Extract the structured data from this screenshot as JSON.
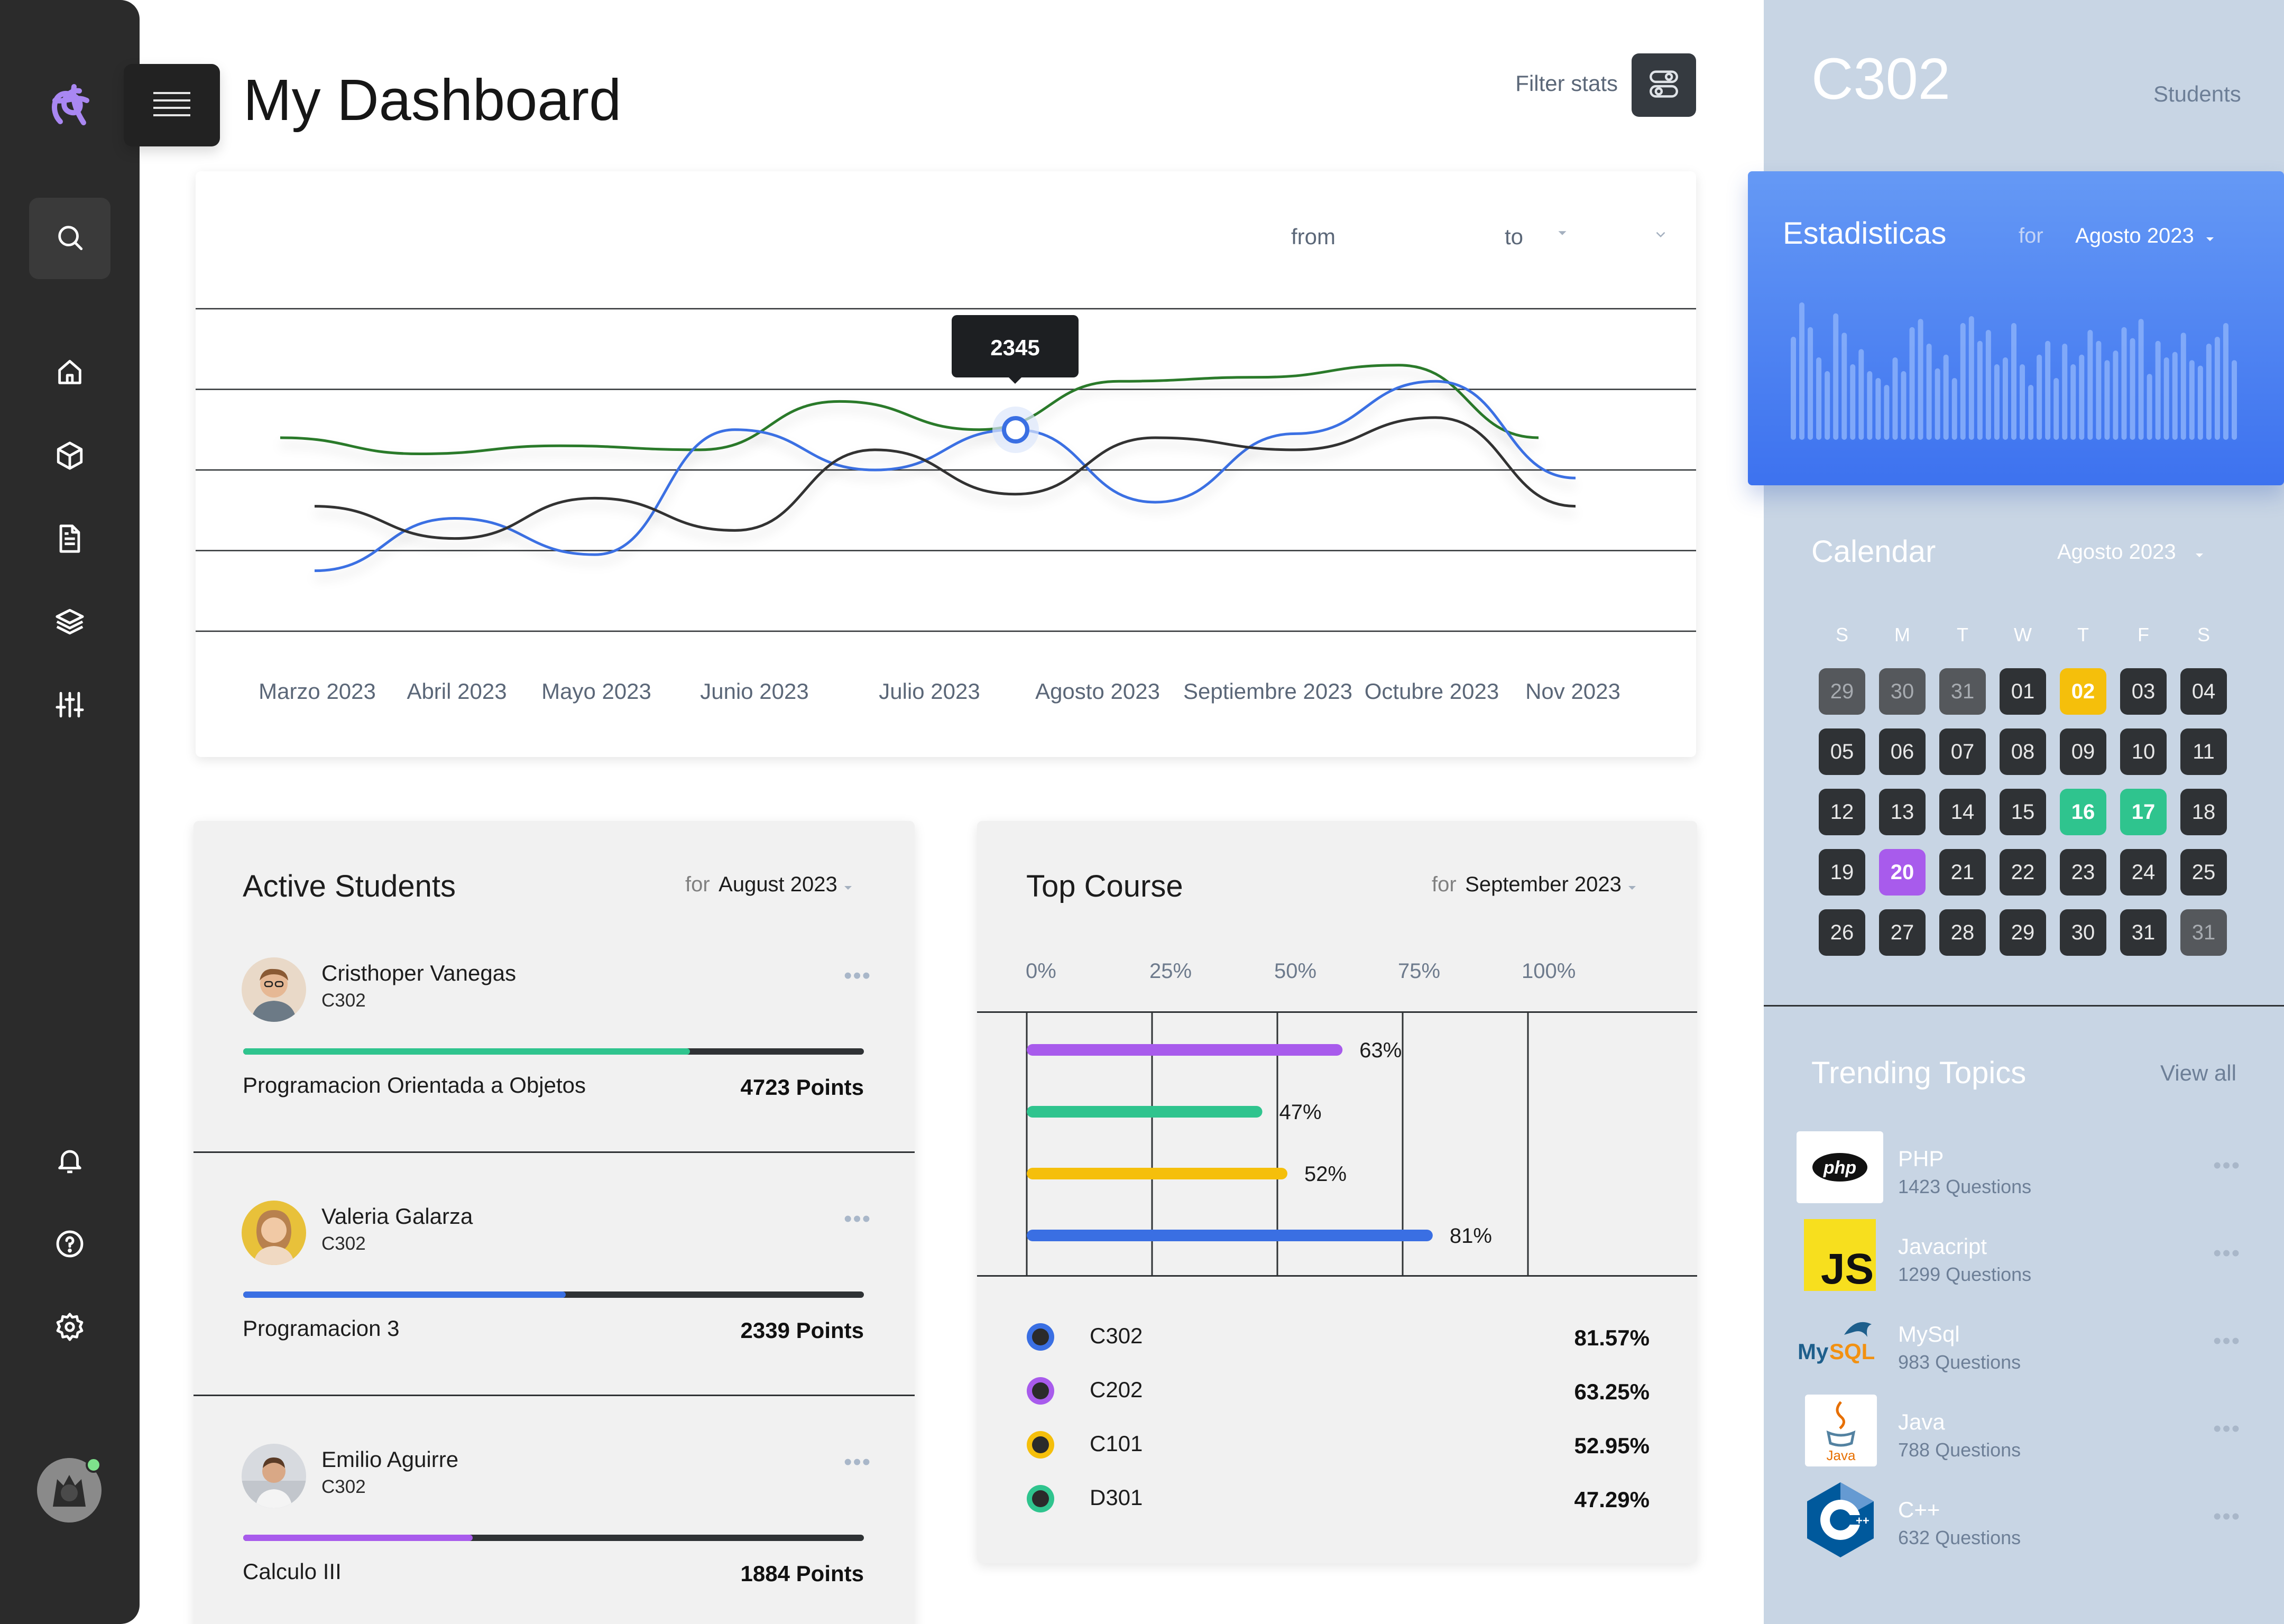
{
  "header": {
    "title": "My Dashboard",
    "filter_label": "Filter stats"
  },
  "sidebar": {
    "logo_icon": "knot-logo",
    "top_items": [
      "search-icon",
      "home-icon",
      "cube-icon",
      "document-icon",
      "layers-icon",
      "sliders-icon"
    ],
    "bottom_items": [
      "bell-icon",
      "help-icon",
      "gear-icon"
    ],
    "user_status": "online"
  },
  "line_chart": {
    "from_label": "from",
    "to_label": "to",
    "tooltip": "2345"
  },
  "chart_data": {
    "type": "line",
    "categories": [
      "Marzo 2023",
      "Abril 2023",
      "Mayo 2023",
      "Junio 2023",
      "Julio 2023",
      "Agosto 2023",
      "Septiembre 2023",
      "Octubre 2023",
      "Nov 2023"
    ],
    "y_domain": [
      0,
      4
    ],
    "grid": true,
    "legend": "none",
    "highlight": {
      "series": 1,
      "index": 4,
      "label": "2345"
    },
    "series": [
      {
        "color": "#2b7a2b",
        "values": [
          2.4,
          2.2,
          2.3,
          2.25,
          2.85,
          2.5,
          3.1,
          3.15,
          3.3,
          2.4
        ]
      },
      {
        "color": "#3a6fe3",
        "values": [
          0.75,
          1.4,
          0.95,
          2.5,
          2.0,
          2.5,
          1.6,
          2.45,
          3.1,
          1.9
        ]
      },
      {
        "color": "#333333",
        "values": [
          1.55,
          1.15,
          1.65,
          1.25,
          2.25,
          1.7,
          2.4,
          2.25,
          2.65,
          1.55
        ]
      }
    ]
  },
  "active_students": {
    "title": "Active Students",
    "for_label": "for",
    "period": "August 2023",
    "students": [
      {
        "name": "Cristhoper Vanegas",
        "course": "C302",
        "subject": "Programacion Orientada a Objetos",
        "points": "4723 Points",
        "progress": 0.72,
        "color": "#2fc48e",
        "avatar_bg": "#e9d9c8"
      },
      {
        "name": "Valeria Galarza",
        "course": "C302",
        "subject": "Programacion 3",
        "points": "2339 Points",
        "progress": 0.52,
        "color": "#3a6fe3",
        "avatar_bg": "#e8c13a"
      },
      {
        "name": "Emilio Aguirre",
        "course": "C302",
        "subject": "Calculo III",
        "points": "1884 Points",
        "progress": 0.37,
        "color": "#a85bec",
        "avatar_bg": "#d7dadf"
      }
    ]
  },
  "top_course": {
    "title": "Top Course",
    "for_label": "for",
    "period": "September 2023",
    "ticks": [
      "0%",
      "25%",
      "50%",
      "75%",
      "100%"
    ],
    "bars": [
      {
        "label": "63%",
        "value": 63,
        "color": "#a85bec"
      },
      {
        "label": "47%",
        "value": 47,
        "color": "#2fc48e"
      },
      {
        "label": "52%",
        "value": 52,
        "color": "#f5bf0b"
      },
      {
        "label": "81%",
        "value": 81,
        "color": "#3a6fe3"
      }
    ],
    "legend": [
      {
        "name": "C302",
        "value": "81.57%",
        "color": "#3a6fe3"
      },
      {
        "name": "C202",
        "value": "63.25%",
        "color": "#a85bec"
      },
      {
        "name": "C101",
        "value": "52.95%",
        "color": "#f5bf0b"
      },
      {
        "name": "D301",
        "value": "47.29%",
        "color": "#2fc48e"
      }
    ]
  },
  "right_panel": {
    "class_name": "C302",
    "students_label": "Students",
    "stats": {
      "title": "Estadisticas",
      "for_label": "for",
      "period": "Agosto 2023",
      "bar_values": [
        0.75,
        1.0,
        0.82,
        0.6,
        0.5,
        0.92,
        0.78,
        0.55,
        0.66,
        0.5,
        0.45,
        0.4,
        0.6,
        0.5,
        0.82,
        0.88,
        0.7,
        0.52,
        0.62,
        0.45,
        0.85,
        0.9,
        0.72,
        0.8,
        0.55,
        0.6,
        0.85,
        0.55,
        0.4,
        0.62,
        0.72,
        0.45,
        0.7,
        0.55,
        0.62,
        0.8,
        0.72,
        0.58,
        0.65,
        0.82,
        0.74,
        0.88,
        0.48,
        0.72,
        0.6,
        0.64,
        0.78,
        0.58,
        0.54,
        0.7,
        0.75,
        0.85,
        0.58
      ]
    },
    "calendar": {
      "title": "Calendar",
      "month": "Agosto 2023",
      "weekdays": [
        "S",
        "M",
        "T",
        "W",
        "T",
        "F",
        "S"
      ],
      "days": [
        {
          "d": "29",
          "s": "muted"
        },
        {
          "d": "30",
          "s": "muted"
        },
        {
          "d": "31",
          "s": "muted"
        },
        {
          "d": "01"
        },
        {
          "d": "02",
          "hl": "#f5bf0b"
        },
        {
          "d": "03"
        },
        {
          "d": "04"
        },
        {
          "d": "05"
        },
        {
          "d": "06"
        },
        {
          "d": "07"
        },
        {
          "d": "08"
        },
        {
          "d": "09"
        },
        {
          "d": "10"
        },
        {
          "d": "11"
        },
        {
          "d": "12"
        },
        {
          "d": "13"
        },
        {
          "d": "14"
        },
        {
          "d": "15"
        },
        {
          "d": "16",
          "hl": "#2fc48e"
        },
        {
          "d": "17",
          "hl": "#2fc48e"
        },
        {
          "d": "18"
        },
        {
          "d": "19"
        },
        {
          "d": "20",
          "hl": "#a85bec"
        },
        {
          "d": "21"
        },
        {
          "d": "22"
        },
        {
          "d": "23"
        },
        {
          "d": "24"
        },
        {
          "d": "25"
        },
        {
          "d": "26"
        },
        {
          "d": "27"
        },
        {
          "d": "28"
        },
        {
          "d": "29"
        },
        {
          "d": "30"
        },
        {
          "d": "31"
        },
        {
          "d": "31",
          "s": "muted"
        }
      ]
    },
    "trending": {
      "title": "Trending Topics",
      "view_all": "View all",
      "topics": [
        {
          "name": "PHP",
          "count": "1423 Questions",
          "logo": "php-logo"
        },
        {
          "name": "Javacript",
          "count": "1299 Questions",
          "logo": "js-logo"
        },
        {
          "name": "MySql",
          "count": "983 Questions",
          "logo": "mysql-logo"
        },
        {
          "name": "Java",
          "count": "788 Questions",
          "logo": "java-logo"
        },
        {
          "name": "C++",
          "count": "632 Questions",
          "logo": "cpp-logo"
        }
      ]
    }
  }
}
